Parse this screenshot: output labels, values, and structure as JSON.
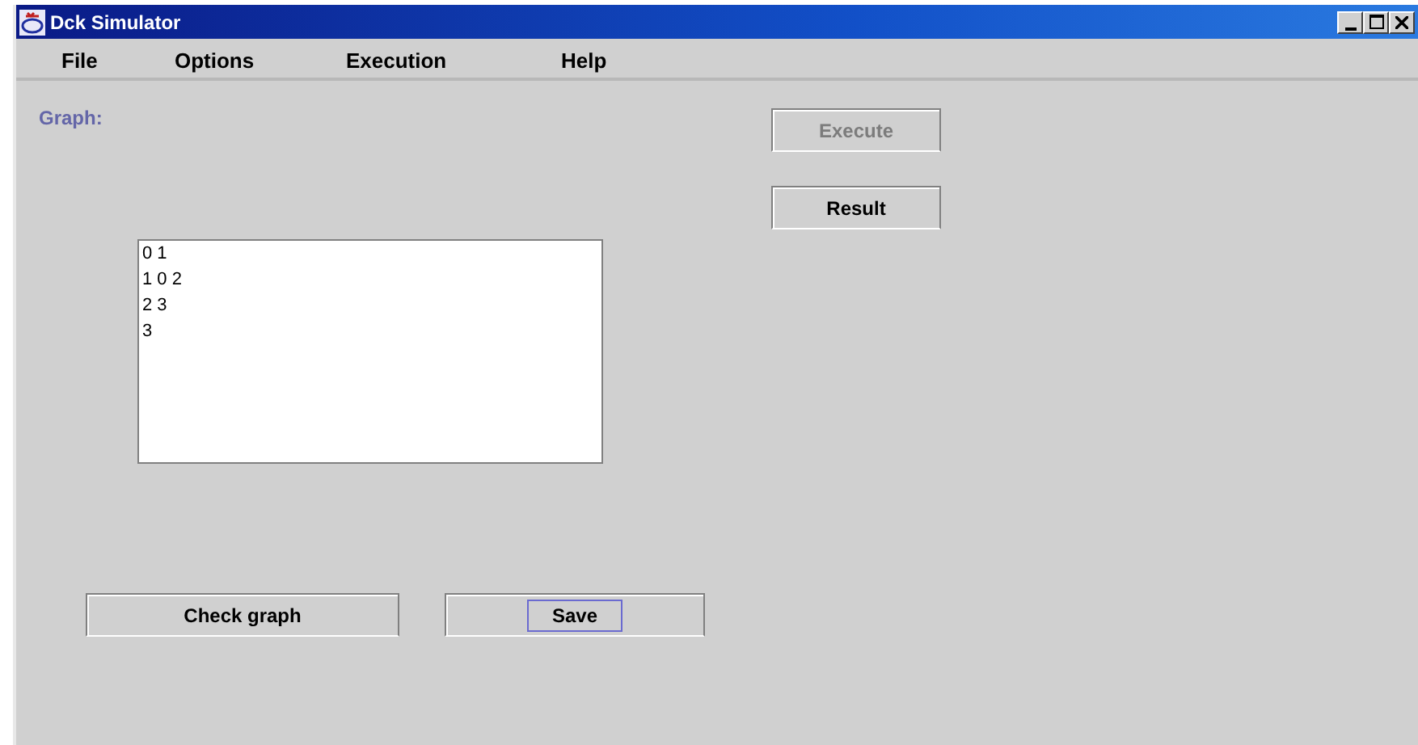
{
  "window": {
    "title": "Dck Simulator"
  },
  "menu": [
    {
      "label": "File"
    },
    {
      "label": "Options"
    },
    {
      "label": "Execution"
    },
    {
      "label": "Help"
    }
  ],
  "graph_label": "Graph:",
  "graph_text": {
    "lines": [
      "0 1",
      "1 0 2",
      "2 3",
      "3"
    ]
  },
  "right_buttons": [
    {
      "label": "Execute",
      "disabled": true,
      "focused": false
    },
    {
      "label": "Result",
      "disabled": false,
      "focused": false
    }
  ],
  "bottom_buttons": [
    {
      "label": "Check graph",
      "disabled": false,
      "focused": false
    },
    {
      "label": "Save",
      "disabled": false,
      "focused": true
    }
  ]
}
